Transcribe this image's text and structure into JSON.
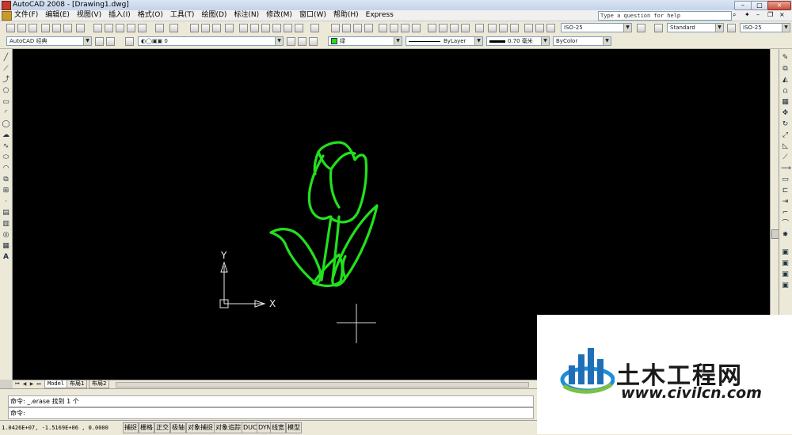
{
  "window": {
    "title": "AutoCAD 2008 - [Drawing1.dwg]",
    "min_label": "–",
    "max_label": "□",
    "close_label": "×"
  },
  "menubar": {
    "items": [
      "文件(F)",
      "编辑(E)",
      "视图(V)",
      "插入(I)",
      "格式(O)",
      "工具(T)",
      "绘图(D)",
      "标注(N)",
      "修改(M)",
      "窗口(W)",
      "帮助(H)",
      "Express"
    ],
    "help_placeholder": "Type a question for help"
  },
  "toolbar1": {
    "dim_style": "ISO-25",
    "text_style": "Standard",
    "table_style": "ISO-25"
  },
  "toolbar2": {
    "workspace": "AutoCAD 经典",
    "layer": "0",
    "color": "绿",
    "linetype": "ByLayer",
    "lineweight": "0.70 毫米",
    "plotstyle": "ByColor"
  },
  "canvas": {
    "background": "#000000",
    "sketch_color": "#22e01e",
    "ucs_x_label": "X",
    "ucs_y_label": "Y"
  },
  "layout_tabs": [
    "Model",
    "布局1",
    "布局2"
  ],
  "command": {
    "history": "命令: _.erase 找到 1 个",
    "prompt": "命令:"
  },
  "statusbar": {
    "coords": "1.0426E+07,  -1.5169E+06 , 0.0000",
    "buttons": [
      "捕捉",
      "栅格",
      "正交",
      "极轴",
      "对象捕捉",
      "对象追踪",
      "DUCS",
      "DYN",
      "线宽",
      "模型"
    ]
  },
  "watermark": {
    "name": "土木工程网",
    "url": "www.civilcn.com"
  }
}
